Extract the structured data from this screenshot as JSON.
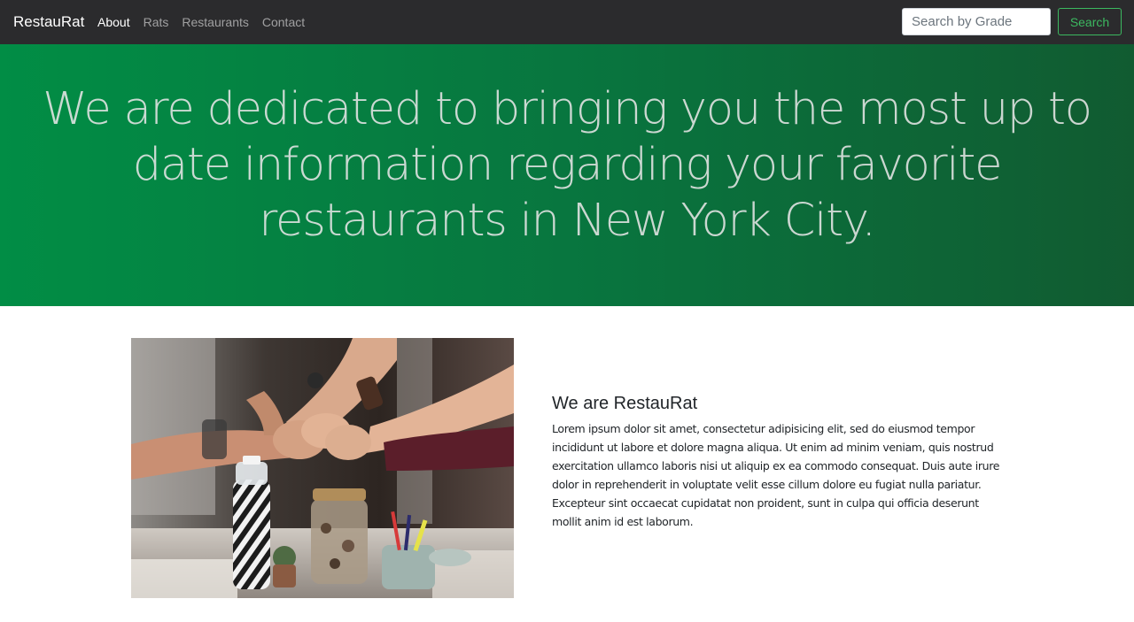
{
  "navbar": {
    "brand": "RestauRat",
    "links": [
      {
        "label": "About",
        "active": true
      },
      {
        "label": "Rats",
        "active": false
      },
      {
        "label": "Restaurants",
        "active": false
      },
      {
        "label": "Contact",
        "active": false
      }
    ],
    "search": {
      "placeholder": "Search by Grade",
      "value": ""
    },
    "search_button": "Search"
  },
  "hero": {
    "text": "We are dedicated to bringing you the most up to date information regarding your favorite restaurants in New York City."
  },
  "about": {
    "image_alt": "team-fist-bump-photo",
    "heading": "We are RestauRat",
    "body": "Lorem ipsum dolor sit amet, consectetur adipisicing elit, sed do eiusmod tempor incididunt ut labore et dolore magna aliqua. Ut enim ad minim veniam, quis nostrud exercitation ullamco laboris nisi ut aliquip ex ea commodo consequat. Duis aute irure dolor in reprehenderit in voluptate velit esse cillum dolore eu fugiat nulla pariatur. Excepteur sint occaecat cupidatat non proident, sunt in culpa qui officia deserunt mollit anim id est laborum."
  },
  "colors": {
    "navbar_bg": "#2b2b2d",
    "hero_gradient_start": "#018d45",
    "hero_gradient_end": "#115b31",
    "accent_green": "#3cb860"
  }
}
